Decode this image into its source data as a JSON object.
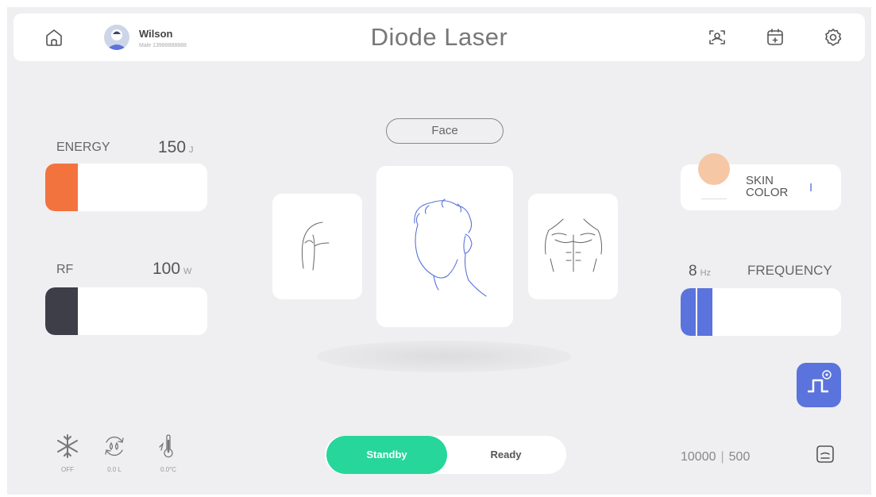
{
  "header": {
    "title": "Diode Laser",
    "user_name": "Wilson",
    "user_sub": "Male 13988888888",
    "icons": [
      "home-icon",
      "avatar",
      "scan-icon",
      "calendar-icon",
      "settings-icon"
    ]
  },
  "energy": {
    "label": "ENERGY",
    "value": "150",
    "unit": "J",
    "level": 0.2,
    "color": "#f3733f"
  },
  "rf": {
    "label": "RF",
    "value": "100",
    "unit": "W",
    "level": 0.2,
    "color": "#3d3e48"
  },
  "region": {
    "selected": "Face",
    "cards": [
      "shoulder",
      "face",
      "chest"
    ]
  },
  "skin": {
    "label_line1": "SKIN",
    "label_line2": "COLOR",
    "level": "I",
    "swatch_color": "#f5c7a4"
  },
  "frequency": {
    "value": "8",
    "unit": "Hz",
    "label": "FREQUENCY",
    "level": 0.2,
    "color": "#5b73dc"
  },
  "mode": {
    "standby": "Standby",
    "ready": "Ready",
    "active": "standby",
    "active_color": "#27d69a"
  },
  "status": {
    "cooling": "OFF",
    "water": "0.0 L",
    "temperature": "0.0°C"
  },
  "counter": {
    "left": "10000",
    "right": "500"
  }
}
